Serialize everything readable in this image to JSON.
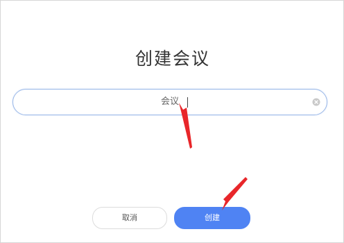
{
  "dialog": {
    "title": "创建会议",
    "meeting_name": {
      "value": "会议"
    },
    "cancel_label": "取消",
    "create_label": "创建"
  },
  "colors": {
    "primary": "#4f83f3",
    "input_border": "#9ab8e8",
    "annotation_arrow": "#e8262a"
  },
  "icons": {
    "clear": "clear-circle-icon"
  }
}
